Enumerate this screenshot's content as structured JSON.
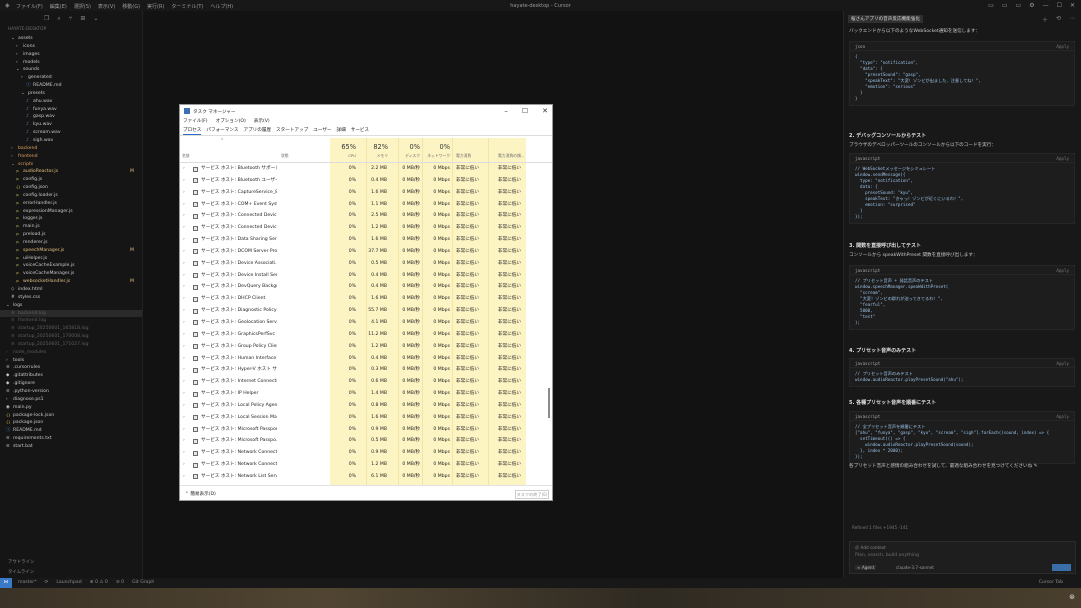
{
  "titlebar": {
    "menus": [
      "ファイル(F)",
      "編集(E)",
      "選択(S)",
      "表示(V)",
      "移動(G)",
      "実行(R)",
      "ターミナル(T)",
      "ヘルプ(H)"
    ],
    "app_title": "hayate-desktop - Cursor"
  },
  "explorer": {
    "header": "HAYATE-DESKTOP",
    "items": [
      {
        "label": "assets",
        "icon": "folder-icon",
        "indent": 1,
        "open": true
      },
      {
        "label": "icons",
        "icon": "folder-icon",
        "indent": 2
      },
      {
        "label": "images",
        "icon": "folder-icon",
        "indent": 2
      },
      {
        "label": "models",
        "icon": "folder-icon",
        "indent": 2
      },
      {
        "label": "sounds",
        "icon": "folder-icon",
        "indent": 2,
        "open": true
      },
      {
        "label": "generated",
        "icon": "folder-icon",
        "indent": 3
      },
      {
        "label": "README.md",
        "icon": "info-icon",
        "indent": 4
      },
      {
        "label": "presets",
        "icon": "folder-icon",
        "indent": 3,
        "open": true
      },
      {
        "label": "ahu.wav",
        "icon": "audio-icon",
        "indent": 4
      },
      {
        "label": "funya.wav",
        "icon": "audio-icon",
        "indent": 4
      },
      {
        "label": "gasp.wav",
        "icon": "audio-icon",
        "indent": 4
      },
      {
        "label": "kyu.wav",
        "icon": "audio-icon",
        "indent": 4
      },
      {
        "label": "scream.wav",
        "icon": "audio-icon",
        "indent": 4
      },
      {
        "label": "sigh.wav",
        "icon": "audio-icon",
        "indent": 4
      },
      {
        "label": "backend",
        "icon": "folder-icon",
        "indent": 1,
        "accent": "#e2a060"
      },
      {
        "label": "frontend",
        "icon": "folder-icon",
        "indent": 1,
        "accent": "#e2a060"
      },
      {
        "label": "scripts",
        "icon": "folder-icon",
        "indent": 1,
        "open": true,
        "accent": "#e2a060"
      },
      {
        "label": "audioReactor.js",
        "icon": "js-icon",
        "indent": 2,
        "badge": "M",
        "accent": "#e2c080"
      },
      {
        "label": "config.js",
        "icon": "js-icon",
        "indent": 2
      },
      {
        "label": "config.json",
        "icon": "json-icon",
        "indent": 2
      },
      {
        "label": "config.loader.js",
        "icon": "js-icon",
        "indent": 2
      },
      {
        "label": "errorHandler.js",
        "icon": "js-icon",
        "indent": 2
      },
      {
        "label": "expressionManager.js",
        "icon": "js-icon",
        "indent": 2
      },
      {
        "label": "logger.js",
        "icon": "js-icon",
        "indent": 2
      },
      {
        "label": "main.js",
        "icon": "js-icon",
        "indent": 2
      },
      {
        "label": "preload.js",
        "icon": "js-icon",
        "indent": 2
      },
      {
        "label": "renderer.js",
        "icon": "js-icon",
        "indent": 2
      },
      {
        "label": "speechManager.js",
        "icon": "js-icon",
        "indent": 2,
        "badge": "M",
        "accent": "#e2c080"
      },
      {
        "label": "uiHelper.js",
        "icon": "js-icon",
        "indent": 2
      },
      {
        "label": "voiceCacheExample.js",
        "icon": "js-icon",
        "indent": 2
      },
      {
        "label": "voiceCacheManager.js",
        "icon": "js-icon",
        "indent": 2
      },
      {
        "label": "websocketHandler.js",
        "icon": "js-icon",
        "indent": 2,
        "badge": "M",
        "accent": "#e2c080"
      },
      {
        "label": "index.html",
        "icon": "html-icon",
        "indent": 1
      },
      {
        "label": "styles.css",
        "icon": "css-icon",
        "indent": 1
      },
      {
        "label": "logs",
        "icon": "folder-icon",
        "indent": 0,
        "open": true
      },
      {
        "label": "backend.log",
        "icon": "log-icon",
        "indent": 1,
        "dim": true,
        "selected": true
      },
      {
        "label": "frontend.log",
        "icon": "log-icon",
        "indent": 1,
        "dim": true
      },
      {
        "label": "startup_20250601_165818.log",
        "icon": "log-icon",
        "indent": 1,
        "dim": true
      },
      {
        "label": "startup_20250601_170008.log",
        "icon": "log-icon",
        "indent": 1,
        "dim": true
      },
      {
        "label": "startup_20250601_171027.log",
        "icon": "log-icon",
        "indent": 1,
        "dim": true
      },
      {
        "label": "node_modules",
        "icon": "folder-icon",
        "indent": 0,
        "dim": true
      },
      {
        "label": "tools",
        "icon": "folder-icon",
        "indent": 0
      },
      {
        "label": ".cursorrules",
        "icon": "file-icon",
        "indent": 0
      },
      {
        "label": ".gitattributes",
        "icon": "git-icon",
        "indent": 0
      },
      {
        "label": ".gitignore",
        "icon": "git-icon",
        "indent": 0
      },
      {
        "label": ".python-version",
        "icon": "file-icon",
        "indent": 0
      },
      {
        "label": "diagnose.ps1",
        "icon": "ps-icon",
        "indent": 0
      },
      {
        "label": "main.py",
        "icon": "py-icon",
        "indent": 0
      },
      {
        "label": "package-lock.json",
        "icon": "json-icon",
        "indent": 0
      },
      {
        "label": "package.json",
        "icon": "json-icon",
        "indent": 0
      },
      {
        "label": "README.md",
        "icon": "info-icon",
        "indent": 0
      },
      {
        "label": "requirements.txt",
        "icon": "file-icon",
        "indent": 0
      },
      {
        "label": "start.bat",
        "icon": "file-icon",
        "indent": 0
      }
    ],
    "outline": [
      "アウトライン",
      "タイムライン"
    ]
  },
  "statusbar": {
    "left": [
      "master*",
      "⟳",
      "Launchpad",
      "⊗ 0 ⚠ 0",
      "⊘ 0",
      "Git Graph"
    ],
    "right": "Cursor Tab"
  },
  "taskmanager": {
    "title": "タスク マネージャー",
    "menu": [
      "ファイル(F)",
      "オプション(O)",
      "表示(V)"
    ],
    "tabs": [
      "プロセス",
      "パフォーマンス",
      "アプリの履歴",
      "スタートアップ",
      "ユーザー",
      "詳細",
      "サービス"
    ],
    "active_tab": 0,
    "columns": {
      "name": "名前",
      "status": "状態",
      "cpu": {
        "pct": "65%",
        "label": "CPU"
      },
      "memory": {
        "pct": "82%",
        "label": "メモリ"
      },
      "disk": {
        "pct": "0%",
        "label": "ディスク"
      },
      "network": {
        "pct": "0%",
        "label": "ネットワーク"
      },
      "power": "電力消費",
      "power_trend": "電力消費の傾..."
    },
    "rows": [
      {
        "name": "サービス ホスト: Bluetooth サポート...",
        "cpu": "0%",
        "mem": "2.2 MB",
        "disk": "0 MB/秒",
        "net": "0 Mbps",
        "power": "非常に低い",
        "trend": "非常に低い"
      },
      {
        "name": "サービス ホスト: Bluetooth ユーザー...",
        "cpu": "0%",
        "mem": "0.4 MB",
        "disk": "0 MB/秒",
        "net": "0 Mbps",
        "power": "非常に低い",
        "trend": "非常に低い"
      },
      {
        "name": "サービス ホスト: CaptureService_8a...",
        "cpu": "0%",
        "mem": "1.6 MB",
        "disk": "0 MB/秒",
        "net": "0 Mbps",
        "power": "非常に低い",
        "trend": "非常に低い"
      },
      {
        "name": "サービス ホスト: COM+ Event System",
        "cpu": "0%",
        "mem": "1.1 MB",
        "disk": "0 MB/秒",
        "net": "0 Mbps",
        "power": "非常に低い",
        "trend": "非常に低い"
      },
      {
        "name": "サービス ホスト: Connected Device...",
        "cpu": "0%",
        "mem": "2.5 MB",
        "disk": "0 MB/秒",
        "net": "0 Mbps",
        "power": "非常に低い",
        "trend": "非常に低い"
      },
      {
        "name": "サービス ホスト: Connected Device...",
        "cpu": "0%",
        "mem": "1.2 MB",
        "disk": "0 MB/秒",
        "net": "0 Mbps",
        "power": "非常に低い",
        "trend": "非常に低い"
      },
      {
        "name": "サービス ホスト: Data Sharing Service",
        "cpu": "0%",
        "mem": "1.6 MB",
        "disk": "0 MB/秒",
        "net": "0 Mbps",
        "power": "非常に低い",
        "trend": "非常に低い"
      },
      {
        "name": "サービス ホスト: DCOM Server Proc...",
        "cpu": "0%",
        "mem": "37.7 MB",
        "disk": "0 MB/秒",
        "net": "0 Mbps",
        "power": "非常に低い",
        "trend": "非常に低い"
      },
      {
        "name": "サービス ホスト: Device Associati...",
        "cpu": "0%",
        "mem": "0.5 MB",
        "disk": "0 MB/秒",
        "net": "0 Mbps",
        "power": "非常に低い",
        "trend": "非常に低い"
      },
      {
        "name": "サービス ホスト: Device Install Servi...",
        "cpu": "0%",
        "mem": "0.4 MB",
        "disk": "0 MB/秒",
        "net": "0 Mbps",
        "power": "非常に低い",
        "trend": "非常に低い"
      },
      {
        "name": "サービス ホスト: DevQuery Backgro...",
        "cpu": "0%",
        "mem": "0.4 MB",
        "disk": "0 MB/秒",
        "net": "0 Mbps",
        "power": "非常に低い",
        "trend": "非常に低い"
      },
      {
        "name": "サービス ホスト: DHCP Client",
        "cpu": "0%",
        "mem": "1.6 MB",
        "disk": "0 MB/秒",
        "net": "0 Mbps",
        "power": "非常に低い",
        "trend": "非常に低い"
      },
      {
        "name": "サービス ホスト: Diagnostic Policy ...",
        "cpu": "0%",
        "mem": "55.7 MB",
        "disk": "0 MB/秒",
        "net": "0 Mbps",
        "power": "非常に低い",
        "trend": "非常に低い"
      },
      {
        "name": "サービス ホスト: Geolocation Service",
        "cpu": "0%",
        "mem": "4.1 MB",
        "disk": "0 MB/秒",
        "net": "0 Mbps",
        "power": "非常に低い",
        "trend": "非常に低い"
      },
      {
        "name": "サービス ホスト: GraphicsPerfSvc",
        "cpu": "0%",
        "mem": "11.2 MB",
        "disk": "0 MB/秒",
        "net": "0 Mbps",
        "power": "非常に低い",
        "trend": "非常に低い"
      },
      {
        "name": "サービス ホスト: Group Policy Client",
        "cpu": "0%",
        "mem": "1.2 MB",
        "disk": "0 MB/秒",
        "net": "0 Mbps",
        "power": "非常に低い",
        "trend": "非常に低い"
      },
      {
        "name": "サービス ホスト: Human Interface ...",
        "cpu": "0%",
        "mem": "0.4 MB",
        "disk": "0 MB/秒",
        "net": "0 Mbps",
        "power": "非常に低い",
        "trend": "非常に低い"
      },
      {
        "name": "サービス ホスト: Hyper-V ホスト サービス",
        "cpu": "0%",
        "mem": "0.3 MB",
        "disk": "0 MB/秒",
        "net": "0 Mbps",
        "power": "非常に低い",
        "trend": "非常に低い"
      },
      {
        "name": "サービス ホスト: Internet Connectio...",
        "cpu": "0%",
        "mem": "0.6 MB",
        "disk": "0 MB/秒",
        "net": "0 Mbps",
        "power": "非常に低い",
        "trend": "非常に低い"
      },
      {
        "name": "サービス ホスト: IP Helper",
        "cpu": "0%",
        "mem": "1.4 MB",
        "disk": "0 MB/秒",
        "net": "0 Mbps",
        "power": "非常に低い",
        "trend": "非常に低い"
      },
      {
        "name": "サービス ホスト: Local Policy Agent",
        "cpu": "0%",
        "mem": "0.8 MB",
        "disk": "0 MB/秒",
        "net": "0 Mbps",
        "power": "非常に低い",
        "trend": "非常に低い"
      },
      {
        "name": "サービス ホスト: Local Session Man...",
        "cpu": "0%",
        "mem": "1.6 MB",
        "disk": "0 MB/秒",
        "net": "0 Mbps",
        "power": "非常に低い",
        "trend": "非常に低い"
      },
      {
        "name": "サービス ホスト: Microsoft Passport",
        "cpu": "0%",
        "mem": "0.9 MB",
        "disk": "0 MB/秒",
        "net": "0 Mbps",
        "power": "非常に低い",
        "trend": "非常に低い"
      },
      {
        "name": "サービス ホスト: Microsoft Passpo...",
        "cpu": "0%",
        "mem": "0.5 MB",
        "disk": "0 MB/秒",
        "net": "0 Mbps",
        "power": "非常に低い",
        "trend": "非常に低い"
      },
      {
        "name": "サービス ホスト: Network Connecte...",
        "cpu": "0%",
        "mem": "0.9 MB",
        "disk": "0 MB/秒",
        "net": "0 Mbps",
        "power": "非常に低い",
        "trend": "非常に低い"
      },
      {
        "name": "サービス ホスト: Network Connecti...",
        "cpu": "0%",
        "mem": "1.2 MB",
        "disk": "0 MB/秒",
        "net": "0 Mbps",
        "power": "非常に低い",
        "trend": "非常に低い"
      },
      {
        "name": "サービス ホスト: Network List Service",
        "cpu": "0%",
        "mem": "6.1 MB",
        "disk": "0 MB/秒",
        "net": "0 Mbps",
        "power": "非常に低い",
        "trend": "非常に低い"
      }
    ],
    "footer_fewer": "簡易表示(D)",
    "footer_endtask": "タスクの終了(E)"
  },
  "chat": {
    "tab_title": "桜さんアプリの音声反応機能強化",
    "intro": "バックエンドから以下のようなWebSocket通知を送信します：",
    "sections": [
      {
        "id": "s1",
        "heading": "",
        "lang": "json",
        "apply": "Apply",
        "code": "{\n  \"type\": \"notification\",\n  \"data\": {\n    \"presetSound\": \"gasp\",\n    \"speakText\": \"大変！ゾンビが出ました、注意してね！\",\n    \"emotion\": \"serious\"\n  }\n}"
      },
      {
        "id": "s2",
        "heading": "2. デバッグコンソールからテスト",
        "desc": "ブラウザのデベロッパーツールのコンソールから以下のコードを実行：",
        "lang": "javascript",
        "apply": "Apply",
        "code": "// WebSocketメッセージをシミュレート\nwindow.sendMessage({\n  type: \"notification\",\n  data: {\n    presetSound: \"kyu\",\n    speakText: \"きゃっ！ゾンビが近くにいるわ！\",\n    emotion: \"surprised\"\n  }\n});"
      },
      {
        "id": "s3",
        "heading": "3. 関数を直接呼び出してテスト",
        "desc": "コンソールから speakWithPreset 関数を直接呼び出します：",
        "lang": "javascript",
        "apply": "Apply",
        "code": "// プリセット音声 + 発話音声のテスト\nwindow.speechManager.speakWithPreset(\n  \"scream\",\n  \"大変！ゾンビの群れが迫ってきてるわ！\",\n  \"fearful\",\n  5000,\n  \"test\"\n);"
      },
      {
        "id": "s4",
        "heading": "4. プリセット音声のみテスト",
        "lang": "javascript",
        "apply": "Apply",
        "code": "// プリセット音声のみテスト\nwindow.audioReactor.playPresetSound(\"ahu\");"
      },
      {
        "id": "s5",
        "heading": "5. 各種プリセット音声を順番にテスト",
        "lang": "javascript",
        "apply": "Apply",
        "code": "// 全プリセット音声を順番にテスト\n[\"ahu\", \"funya\", \"gasp\", \"kyu\", \"scream\", \"sigh\"].forEach((sound, index) => {\n  setTimeout(() => {\n    window.audioReactor.playPresetSound(sound);\n  }, index * 2000);\n});"
      }
    ],
    "closing": "各プリセット音声と感情の組み合わせを試して、最適な組み合わせを見つけてくださいね ✎",
    "review": "Refined 1 files  +1945  -141",
    "composer": {
      "add_context": "Add context",
      "placeholder": "Plan, search, build anything",
      "agent": "Agent",
      "model": "claude-3.7-sonnet"
    }
  },
  "colors": {
    "accent": "#3a78c8",
    "modified": "#e2c080",
    "taskmgr_highlight": "#fdf4c4"
  }
}
